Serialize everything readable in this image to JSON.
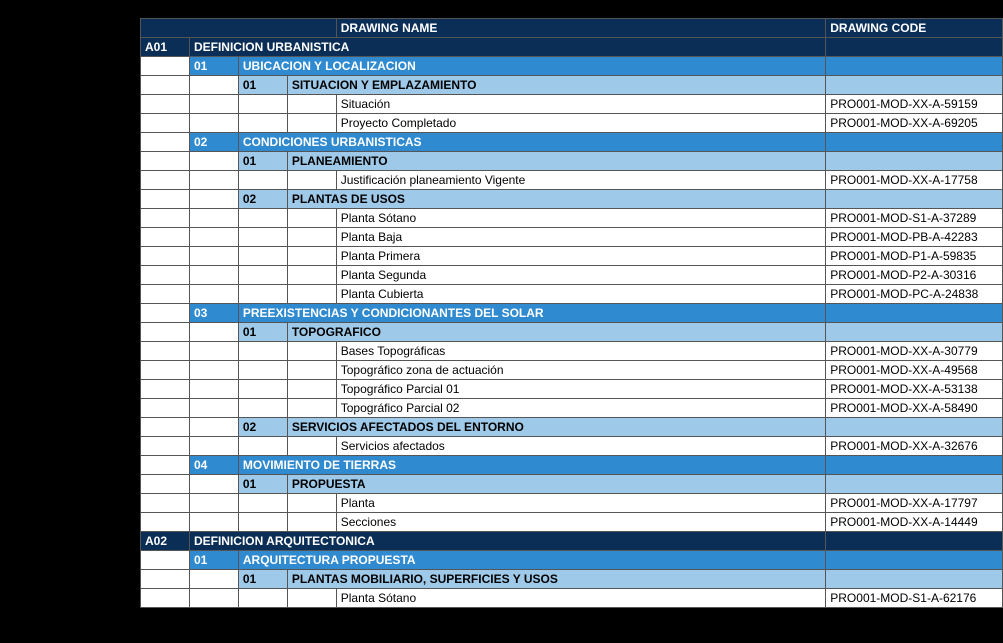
{
  "headers": {
    "name": "DRAWING NAME",
    "code": "DRAWING CODE"
  },
  "rows": [
    {
      "type": "header"
    },
    {
      "type": "lvl0",
      "c0": "A01",
      "title": "DEFINICION URBANISTICA"
    },
    {
      "type": "lvl1",
      "c1": "01",
      "title": "UBICACION Y LOCALIZACION"
    },
    {
      "type": "lvl2",
      "c2": "01",
      "title": "SITUACION Y EMPLAZAMIENTO"
    },
    {
      "type": "leaf",
      "name": "Situación",
      "code": "PRO001-MOD-XX-A-59159"
    },
    {
      "type": "leaf",
      "name": "Proyecto Completado",
      "code": "PRO001-MOD-XX-A-69205"
    },
    {
      "type": "lvl1",
      "c1": "02",
      "title": "CONDICIONES URBANISTICAS"
    },
    {
      "type": "lvl2",
      "c2": "01",
      "title": "PLANEAMIENTO"
    },
    {
      "type": "leaf",
      "name": "Justificación planeamiento Vigente",
      "code": "PRO001-MOD-XX-A-17758"
    },
    {
      "type": "lvl2",
      "c2": "02",
      "title": "PLANTAS DE USOS"
    },
    {
      "type": "leaf",
      "name": "Planta Sótano",
      "code": "PRO001-MOD-S1-A-37289"
    },
    {
      "type": "leaf",
      "name": "Planta Baja",
      "code": "PRO001-MOD-PB-A-42283"
    },
    {
      "type": "leaf",
      "name": "Planta Primera",
      "code": "PRO001-MOD-P1-A-59835"
    },
    {
      "type": "leaf",
      "name": "Planta Segunda",
      "code": "PRO001-MOD-P2-A-30316"
    },
    {
      "type": "leaf",
      "name": "Planta Cubierta",
      "code": "PRO001-MOD-PC-A-24838"
    },
    {
      "type": "lvl1",
      "c1": "03",
      "title": "PREEXISTENCIAS Y CONDICIONANTES DEL SOLAR"
    },
    {
      "type": "lvl2",
      "c2": "01",
      "title": "TOPOGRAFICO"
    },
    {
      "type": "leaf",
      "name": "Bases Topográficas",
      "code": "PRO001-MOD-XX-A-30779"
    },
    {
      "type": "leaf",
      "name": "Topográfico zona de actuación",
      "code": "PRO001-MOD-XX-A-49568"
    },
    {
      "type": "leaf",
      "name": "Topográfico Parcial 01",
      "code": "PRO001-MOD-XX-A-53138"
    },
    {
      "type": "leaf",
      "name": "Topográfico Parcial 02",
      "code": "PRO001-MOD-XX-A-58490"
    },
    {
      "type": "lvl2",
      "c2": "02",
      "title": "SERVICIOS AFECTADOS DEL ENTORNO"
    },
    {
      "type": "leaf",
      "name": "Servicios afectados",
      "code": "PRO001-MOD-XX-A-32676"
    },
    {
      "type": "lvl1",
      "c1": "04",
      "title": "MOVIMIENTO DE TIERRAS"
    },
    {
      "type": "lvl2",
      "c2": "01",
      "title": "PROPUESTA"
    },
    {
      "type": "leaf",
      "name": "Planta",
      "code": "PRO001-MOD-XX-A-17797"
    },
    {
      "type": "leaf",
      "name": "Secciones",
      "code": "PRO001-MOD-XX-A-14449"
    },
    {
      "type": "lvl0",
      "c0": "A02",
      "title": "DEFINICION ARQUITECTONICA"
    },
    {
      "type": "lvl1",
      "c1": "01",
      "title": "ARQUITECTURA PROPUESTA"
    },
    {
      "type": "lvl2",
      "c2": "01",
      "title": "PLANTAS MOBILIARIO, SUPERFICIES Y USOS"
    },
    {
      "type": "leaf",
      "name": "Planta Sótano",
      "code": "PRO001-MOD-S1-A-62176"
    }
  ]
}
